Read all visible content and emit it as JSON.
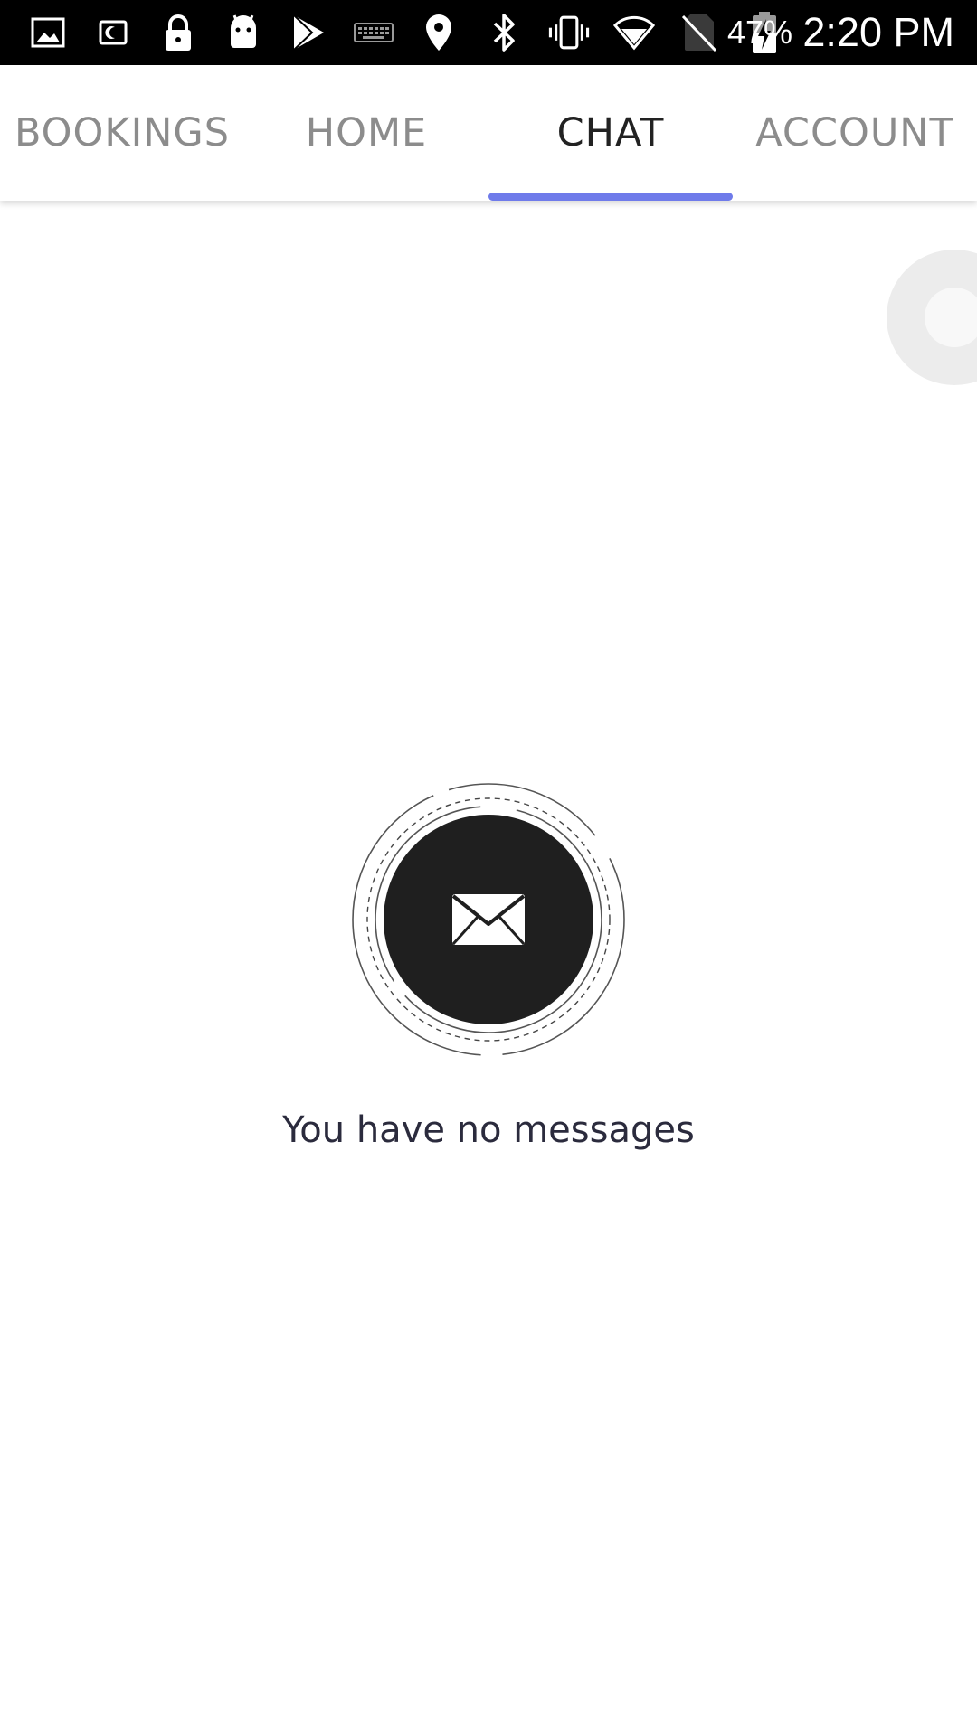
{
  "status_bar": {
    "icons": [
      "gallery-icon",
      "screen-icon",
      "lock-icon",
      "android-icon",
      "play-store-icon",
      "keyboard-icon",
      "location-icon",
      "bluetooth-icon",
      "vibrate-icon",
      "wifi-icon",
      "no-sim-icon",
      "battery-charging-icon"
    ],
    "battery_percent": "47%",
    "time": "2:20 PM"
  },
  "tabs": [
    {
      "label": "BOOKINGS",
      "active": false
    },
    {
      "label": "HOME",
      "active": false
    },
    {
      "label": "CHAT",
      "active": true
    },
    {
      "label": "ACCOUNT",
      "active": false
    }
  ],
  "colors": {
    "accent": "#6f7bea",
    "active_tab_text": "#222222",
    "inactive_tab_text": "#8c8c8c",
    "empty_icon_fill": "#1f1f1f",
    "empty_text": "#2b2b3d"
  },
  "empty_state": {
    "icon": "envelope-icon",
    "message": "You have no messages"
  }
}
